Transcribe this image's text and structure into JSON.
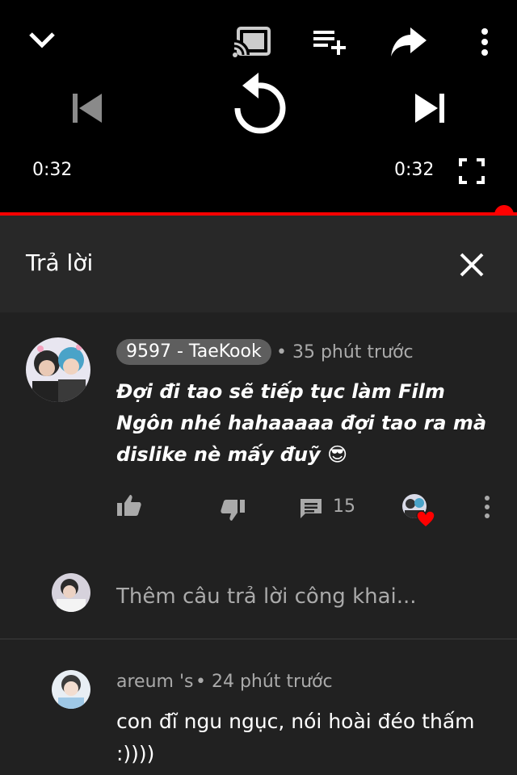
{
  "player": {
    "current_time": "0:32",
    "duration": "0:32",
    "progress": 1.0,
    "icons": [
      "chevron-down-icon",
      "cast-icon",
      "add-to-queue-icon",
      "share-icon",
      "more-vert-icon",
      "skip-previous-icon",
      "replay-icon",
      "skip-next-icon",
      "fullscreen-icon"
    ]
  },
  "reply_panel": {
    "title": "Trả lời",
    "close_icon": "close-icon"
  },
  "comment": {
    "author": "9597 - TaeKook",
    "time": "• 35 phút trước",
    "text": "Đợi đi tao sẽ tiếp tục làm Film Ngôn nhé hahaaaaa đợi tao ra mà dislike nè mấy đuỹ 😎",
    "reply_count": "15"
  },
  "reply_input": {
    "placeholder": "Thêm câu trả lời công khai..."
  },
  "replies": [
    {
      "author": "areum 's",
      "time": "• 24 phút trước",
      "text": "con đĩ ngu ngục, nói hoài đéo thấm :))))"
    }
  ],
  "colors": {
    "accent": "#ff0000",
    "background": "#212121",
    "header": "#282828",
    "player": "#000000",
    "secondary_text": "#aaaaaa"
  }
}
